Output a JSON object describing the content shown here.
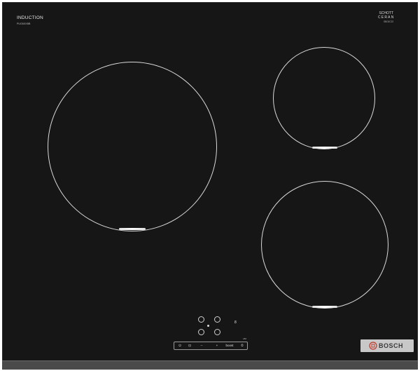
{
  "product": {
    "type_label": "INDUCTION",
    "model_label": "PUG6XXBB",
    "glass_brand_line1": "SCHOTT",
    "glass_brand_line2": "CERAN",
    "glass_code": "SBC6C22",
    "brand": "BOSCH"
  },
  "controls": {
    "indicator_label": "8",
    "bar_label": "L80"
  },
  "colors": {
    "glass": "#161616",
    "ring": "#d9d9d9",
    "plate": "#c8c8c8"
  },
  "icons": [
    "power-icon",
    "child-lock-icon",
    "minus-icon",
    "plus-icon",
    "boost-icon",
    "timer-icon"
  ],
  "bar_items": [
    "⏻",
    "⊡",
    "–",
    "+",
    "boost",
    "⏲"
  ]
}
